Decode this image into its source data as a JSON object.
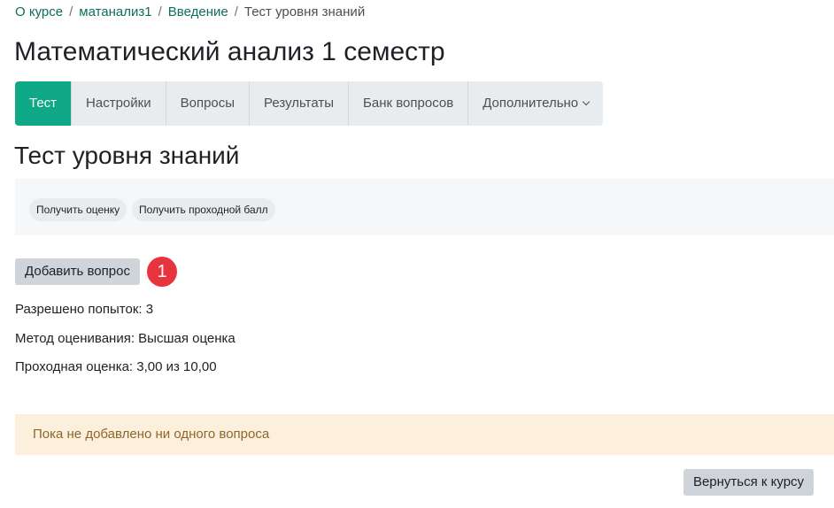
{
  "breadcrumb": {
    "items": [
      "О курсе",
      "матанализ1",
      "Введение"
    ],
    "current": "Тест уровня знаний",
    "separator": "/"
  },
  "course_title": "Математический анализ 1 семестр",
  "tabs": [
    {
      "label": "Тест",
      "active": true
    },
    {
      "label": "Настройки",
      "active": false
    },
    {
      "label": "Вопросы",
      "active": false
    },
    {
      "label": "Результаты",
      "active": false
    },
    {
      "label": "Банк вопросов",
      "active": false
    },
    {
      "label": "Дополнительно",
      "active": false,
      "has_dropdown": true
    }
  ],
  "quiz_title": "Тест уровня знаний",
  "actions": {
    "get_grade": "Получить оценку",
    "get_passing_grade": "Получить проходной балл"
  },
  "add_question_label": "Добавить вопрос",
  "step_badge": "1",
  "info": {
    "attempts": "Разрешено попыток: 3",
    "grading_method": "Метод оценивания: Высшая оценка",
    "passing_grade": "Проходная оценка: 3,00 из 10,00"
  },
  "alert_text": "Пока не добавлено ни одного вопроса",
  "back_label": "Вернуться к курсу",
  "colors": {
    "accent": "#0fa987",
    "link": "#0f6e5c",
    "badge": "#e8343e",
    "alert_bg": "#fcefdc"
  }
}
